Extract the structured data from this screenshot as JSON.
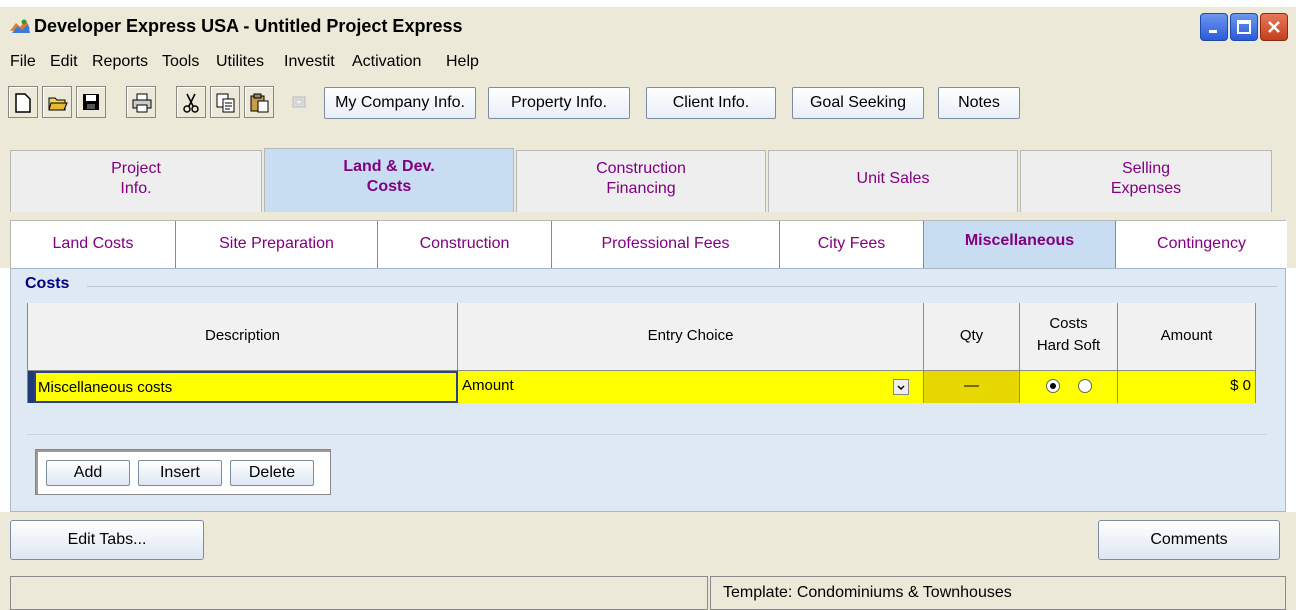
{
  "window": {
    "title": "Developer Express  USA - Untitled Project Express",
    "controls": [
      "minimize-icon",
      "maximize-icon",
      "close-icon"
    ]
  },
  "menu": {
    "items": [
      {
        "label": "File"
      },
      {
        "label": "Edit"
      },
      {
        "label": "Reports"
      },
      {
        "label": "Tools"
      },
      {
        "label": "Utilites"
      },
      {
        "label": "Investit"
      },
      {
        "label": "Activation"
      },
      {
        "label": "Help"
      }
    ]
  },
  "toolbar": {
    "icons": [
      "new-document-icon",
      "open-folder-icon",
      "save-disk-icon",
      "print-icon",
      "cut-icon",
      "copy-icon",
      "paste-icon",
      "disabled-tool-icon"
    ],
    "buttons": [
      {
        "label": "My Company Info."
      },
      {
        "label": "Property Info."
      },
      {
        "label": "Client Info."
      },
      {
        "label": "Goal Seeking"
      },
      {
        "label": "Notes"
      }
    ]
  },
  "main_tabs": [
    {
      "line1": "Project",
      "line2": "Info.",
      "active": false
    },
    {
      "line1": "Land & Dev.",
      "line2": "Costs",
      "active": true
    },
    {
      "line1": "Construction",
      "line2": "Financing",
      "active": false
    },
    {
      "line1": "Unit Sales",
      "line2": "",
      "active": false
    },
    {
      "line1": "Selling",
      "line2": "Expenses",
      "active": false
    }
  ],
  "sub_tabs": [
    {
      "label": "Land Costs",
      "active": false
    },
    {
      "label": "Site Preparation",
      "active": false
    },
    {
      "label": "Construction",
      "active": false
    },
    {
      "label": "Professional Fees",
      "active": false
    },
    {
      "label": "City Fees",
      "active": false
    },
    {
      "label": "Miscellaneous",
      "active": true
    },
    {
      "label": "Contingency",
      "active": false
    }
  ],
  "panel": {
    "title": "Costs",
    "columns": {
      "description": "Description",
      "entry_choice": "Entry Choice",
      "qty": "Qty",
      "costs_line1": "Costs",
      "costs_line2": "Hard Soft",
      "amount": "Amount"
    },
    "rows": [
      {
        "description": "Miscellaneous costs",
        "entry_choice": "Amount",
        "qty": "—",
        "cost_type": "Hard",
        "amount": "$ 0"
      }
    ],
    "row_buttons": [
      {
        "label": "Add"
      },
      {
        "label": "Insert"
      },
      {
        "label": "Delete"
      }
    ]
  },
  "bottom": {
    "edit_tabs": "Edit Tabs...",
    "comments": "Comments"
  },
  "status": {
    "left": "",
    "template": "Template: Condominiums & Townhouses"
  },
  "colors": {
    "tab_text": "#800080",
    "active_tab": "#c8dcf2",
    "row_highlight": "#ffff00",
    "panel_bg": "#dfe9f4",
    "panel_title": "#000080"
  }
}
